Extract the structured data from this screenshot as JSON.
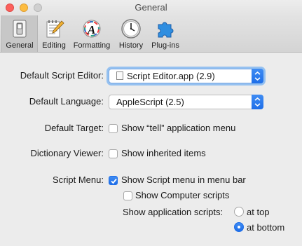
{
  "window": {
    "title": "General"
  },
  "toolbar": {
    "tabs": [
      {
        "label": "General",
        "icon": "switch-icon",
        "active": true
      },
      {
        "label": "Editing",
        "icon": "notepad-pencil-icon",
        "active": false
      },
      {
        "label": "Formatting",
        "icon": "fancy-a-icon",
        "active": false
      },
      {
        "label": "History",
        "icon": "clock-icon",
        "active": false
      },
      {
        "label": "Plug-ins",
        "icon": "puzzle-piece-icon",
        "active": false
      }
    ]
  },
  "settings": {
    "default_script_editor": {
      "label": "Default Script Editor:",
      "value": "Script Editor.app (2.9)"
    },
    "default_language": {
      "label": "Default Language:",
      "value": "AppleScript (2.5)"
    },
    "default_target": {
      "label": "Default Target:",
      "checkbox_label": "Show “tell” application menu",
      "checked": false
    },
    "dictionary_viewer": {
      "label": "Dictionary Viewer:",
      "checkbox_label": "Show inherited items",
      "checked": false
    },
    "script_menu": {
      "label": "Script Menu:",
      "show_menu": {
        "label": "Show Script menu in menu bar",
        "checked": true
      },
      "show_computer": {
        "label": "Show Computer scripts",
        "checked": false
      },
      "app_scripts": {
        "label": "Show application scripts:",
        "options": [
          {
            "label": "at top",
            "selected": false
          },
          {
            "label": "at bottom",
            "selected": true
          }
        ]
      }
    }
  },
  "colors": {
    "accent": "#1e6ee8",
    "close": "#fc605c",
    "minimize": "#fdbc40"
  }
}
